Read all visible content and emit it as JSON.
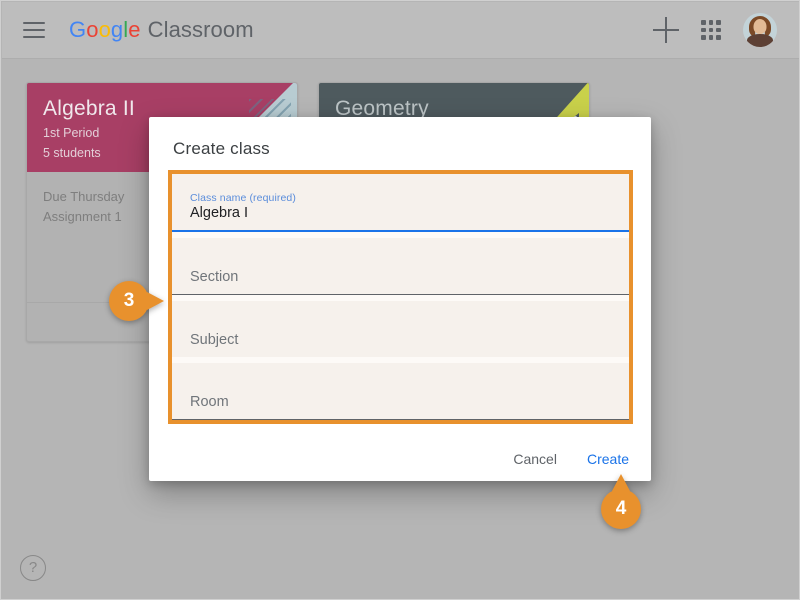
{
  "app": {
    "brand_google": "Google",
    "brand_product": "Classroom",
    "menu_icon": "hamburger-menu-icon",
    "add_icon": "plus-icon",
    "apps_icon": "apps-grid-icon",
    "avatar_icon": "user-avatar",
    "help_icon": "help-question-icon",
    "help_label": "?"
  },
  "cards": [
    {
      "title": "Algebra II",
      "section": "1st Period",
      "students": "5 students",
      "body_line1": "Due Thursday",
      "body_line2": "Assignment 1",
      "header_color": "#a83f65"
    },
    {
      "title": "Geometry",
      "section": "",
      "students": "",
      "body_line1": "",
      "body_line2": "",
      "header_color": "#4e5a5e"
    }
  ],
  "dialog": {
    "title": "Create class",
    "fields": [
      {
        "label": "Class name (required)",
        "value": "Algebra I",
        "placeholder": "",
        "focused": true
      },
      {
        "label": "",
        "value": "",
        "placeholder": "Section",
        "focused": false
      },
      {
        "label": "",
        "value": "",
        "placeholder": "Subject",
        "focused": false
      },
      {
        "label": "",
        "value": "",
        "placeholder": "Room",
        "focused": false
      }
    ],
    "cancel_label": "Cancel",
    "create_label": "Create"
  },
  "callouts": [
    {
      "number": "3"
    },
    {
      "number": "4"
    }
  ],
  "colors": {
    "accent_orange": "#e8912d",
    "link_blue": "#1a73e8",
    "label_blue": "#5b8ddb",
    "page_background": "#b5b5b5",
    "appbar_background": "#bdbdbd"
  }
}
